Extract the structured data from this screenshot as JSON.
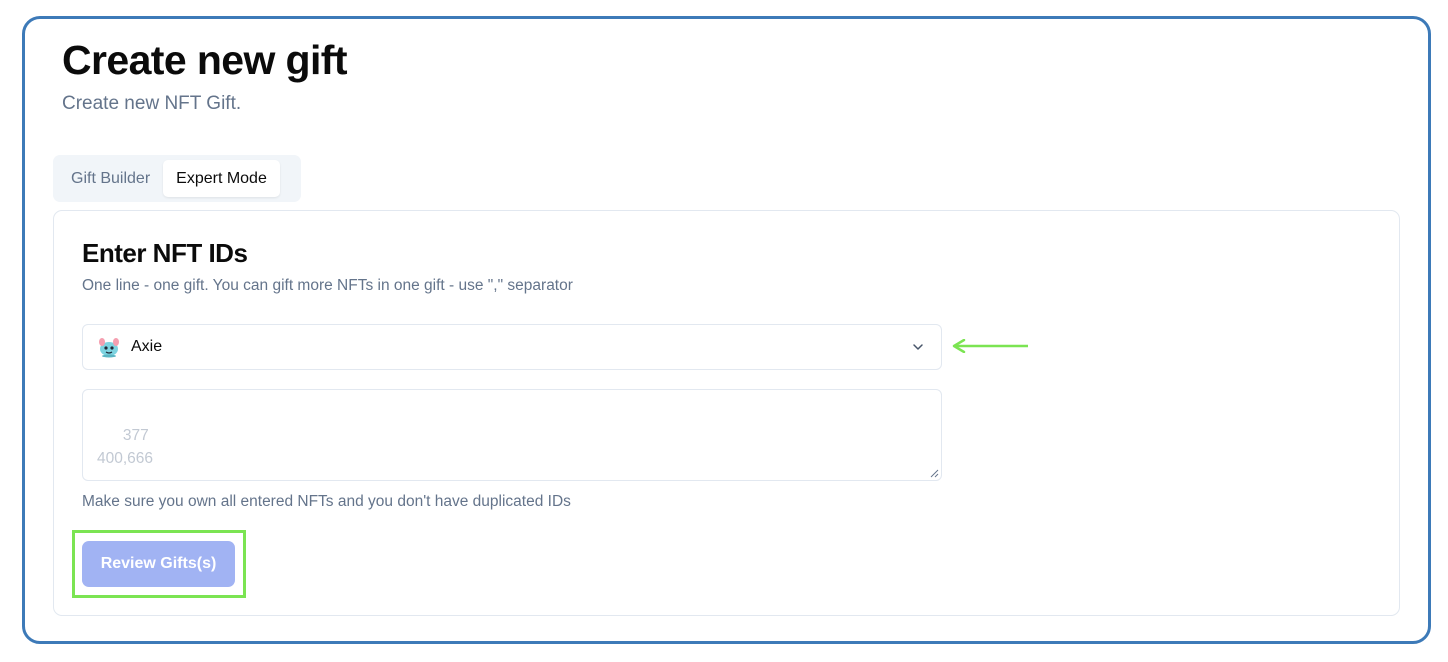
{
  "header": {
    "title": "Create new gift",
    "subtitle": "Create new NFT Gift."
  },
  "tabs": [
    {
      "label": "Gift Builder",
      "active": false
    },
    {
      "label": "Expert Mode",
      "active": true
    }
  ],
  "card": {
    "title": "Enter NFT IDs",
    "description": "One line - one gift. You can gift more NFTs in one gift - use \",\" separator",
    "collection_select": {
      "value": "Axie",
      "icon": "axie-icon"
    },
    "ids_textarea": {
      "placeholder": "377\n400,666",
      "value": ""
    },
    "helper_text": "Make sure you own all entered NFTs and you don't have duplicated IDs",
    "review_button_label": "Review Gifts(s)"
  },
  "colors": {
    "frame_border": "#3d7ab8",
    "annotation_green": "#7be452",
    "button_disabled": "#a1b3f3",
    "muted_text": "#64748b"
  }
}
